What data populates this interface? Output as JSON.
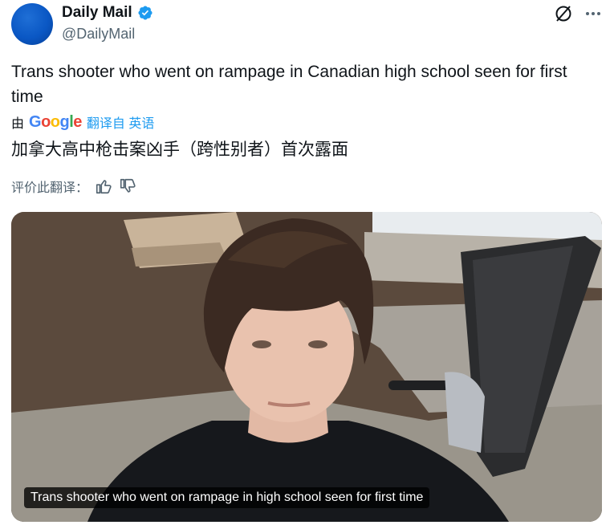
{
  "header": {
    "display_name": "Daily Mail",
    "handle": "@DailyMail",
    "verified": true,
    "icons": [
      "verified-badge-icon",
      "grok-icon",
      "more-icon"
    ]
  },
  "tweet": {
    "text": "Trans shooter who went on rampage in Canadian high school seen for first time"
  },
  "translation": {
    "by_label": "由",
    "provider": "Google",
    "translated_from": "翻译自 英语",
    "text": "加拿大高中枪击案凶手（跨性别者）首次露面",
    "rate_label": "评价此翻译："
  },
  "media": {
    "caption": "Trans shooter who went on rampage in high school seen for first time"
  },
  "colors": {
    "accent": "#1d9bf0",
    "secondary_text": "#536471",
    "avatar": "#0a57c4"
  }
}
